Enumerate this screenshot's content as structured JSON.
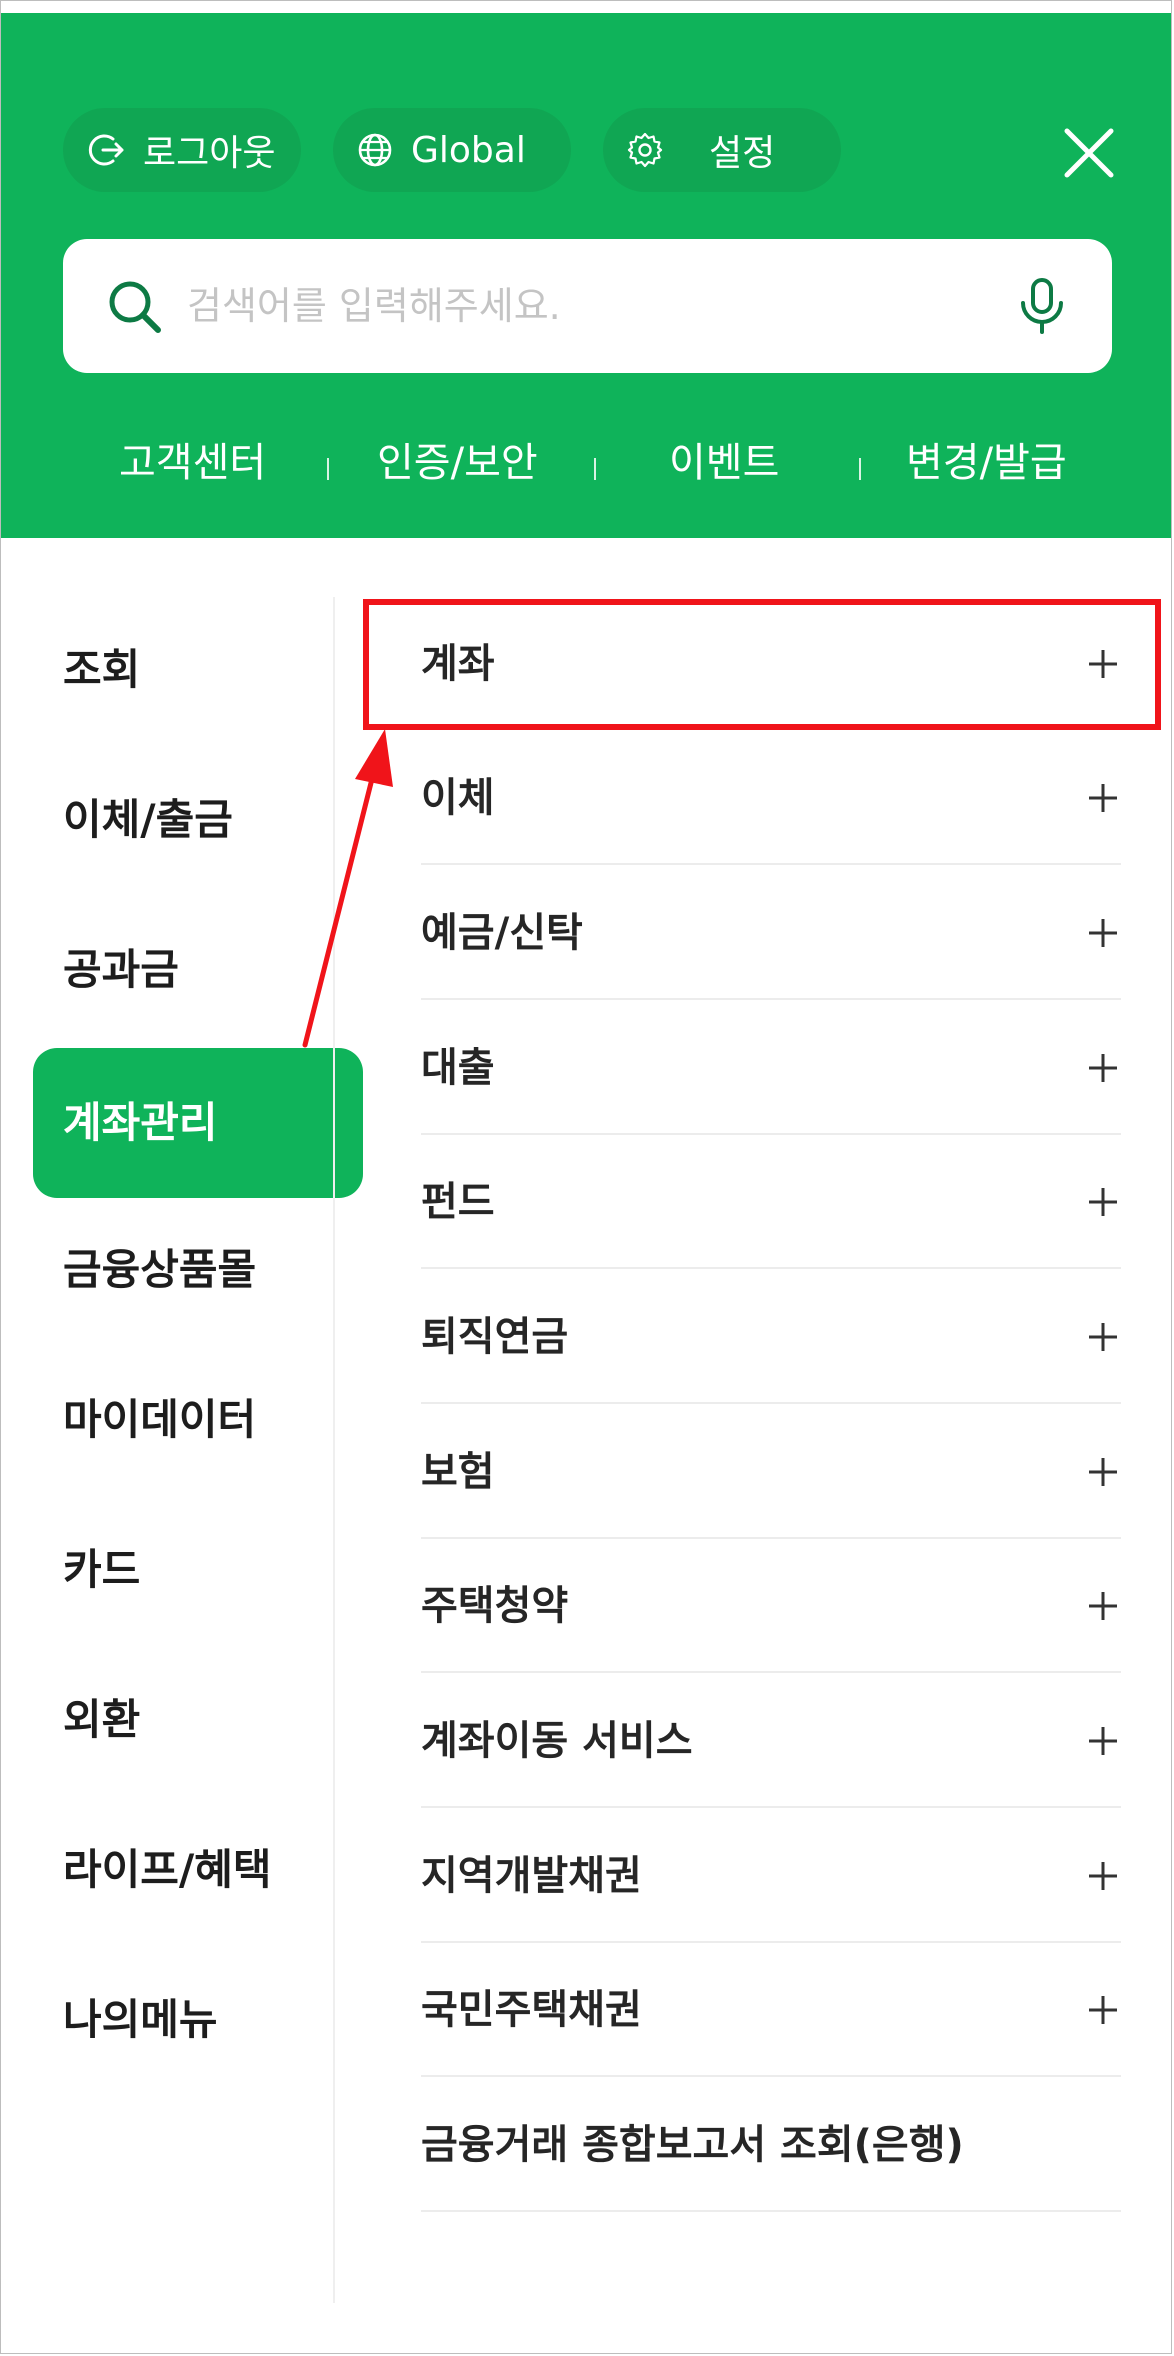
{
  "header": {
    "logout_label": "로그아웃",
    "global_label": "Global",
    "settings_label": "설정",
    "search_placeholder": "검색어를 입력해주세요.",
    "quick_links": [
      "고객센터",
      "인증/보안",
      "이벤트",
      "변경/발급"
    ]
  },
  "categories": [
    {
      "label": "조회"
    },
    {
      "label": "이체/출금"
    },
    {
      "label": "공과금"
    },
    {
      "label": "계좌관리",
      "active": true
    },
    {
      "label": "금융상품몰"
    },
    {
      "label": "마이데이터"
    },
    {
      "label": "카드"
    },
    {
      "label": "외환"
    },
    {
      "label": "라이프/혜택"
    },
    {
      "label": "나의메뉴"
    }
  ],
  "submenu": [
    {
      "label": "계좌",
      "expandable": true
    },
    {
      "label": "이체",
      "expandable": true
    },
    {
      "label": "예금/신탁",
      "expandable": true
    },
    {
      "label": "대출",
      "expandable": true
    },
    {
      "label": "펀드",
      "expandable": true
    },
    {
      "label": "퇴직연금",
      "expandable": true
    },
    {
      "label": "보험",
      "expandable": true
    },
    {
      "label": "주택청약",
      "expandable": true
    },
    {
      "label": "계좌이동 서비스",
      "expandable": true
    },
    {
      "label": "지역개발채권",
      "expandable": true
    },
    {
      "label": "국민주택채권",
      "expandable": true
    },
    {
      "label": "금융거래 종합보고서 조회(은행)",
      "expandable": false
    }
  ],
  "colors": {
    "brand_green": "#0fb35a",
    "pill_green": "#10a653",
    "annotation_red": "#f0141a"
  },
  "icons": {
    "logout": "logout-icon",
    "global": "globe-icon",
    "settings": "gear-icon",
    "close": "close-icon",
    "search": "search-icon",
    "mic": "mic-icon",
    "expand": "plus-icon"
  }
}
